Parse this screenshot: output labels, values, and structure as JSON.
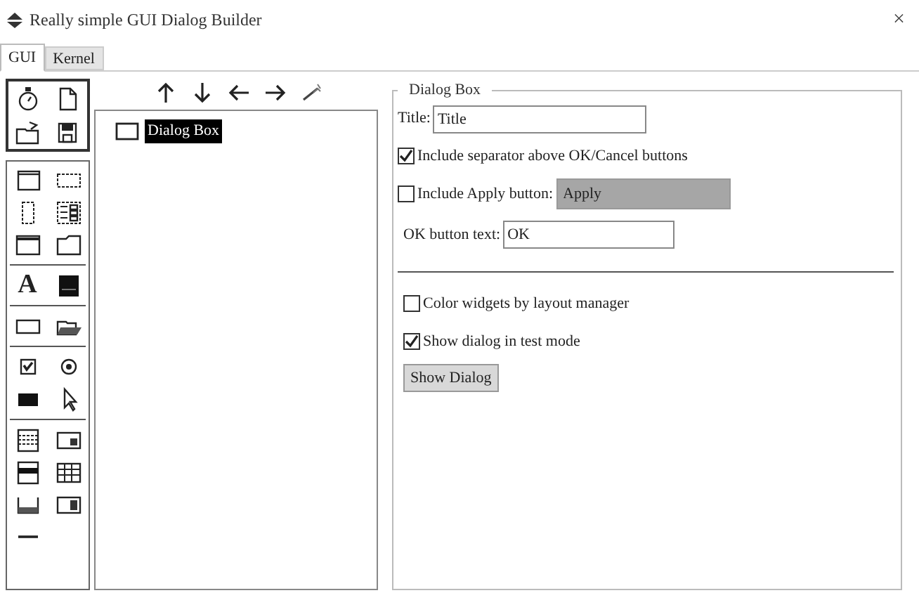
{
  "window": {
    "title": "Really simple GUI Dialog Builder",
    "close": "×"
  },
  "tabs": [
    {
      "label": "GUI",
      "selected": true
    },
    {
      "label": "Kernel",
      "selected": false
    }
  ],
  "palette_glyph": "A",
  "tree": {
    "items": [
      {
        "label": "Dialog Box",
        "selected": true
      }
    ]
  },
  "properties": {
    "legend": "Dialog Box",
    "title_field": {
      "label": "Title:",
      "value": "Title"
    },
    "separator_option": {
      "label": "Include separator above OK/Cancel buttons",
      "checked": true
    },
    "apply_option": {
      "label": "Include Apply button:",
      "checked": false,
      "value": "Apply",
      "disabled": true
    },
    "ok_field": {
      "label": "OK button text:",
      "value": "OK"
    },
    "options": [
      {
        "label": "Color widgets by layout manager",
        "checked": false
      },
      {
        "label": "Show dialog in test mode",
        "checked": true
      }
    ],
    "button": "Show Dialog"
  }
}
